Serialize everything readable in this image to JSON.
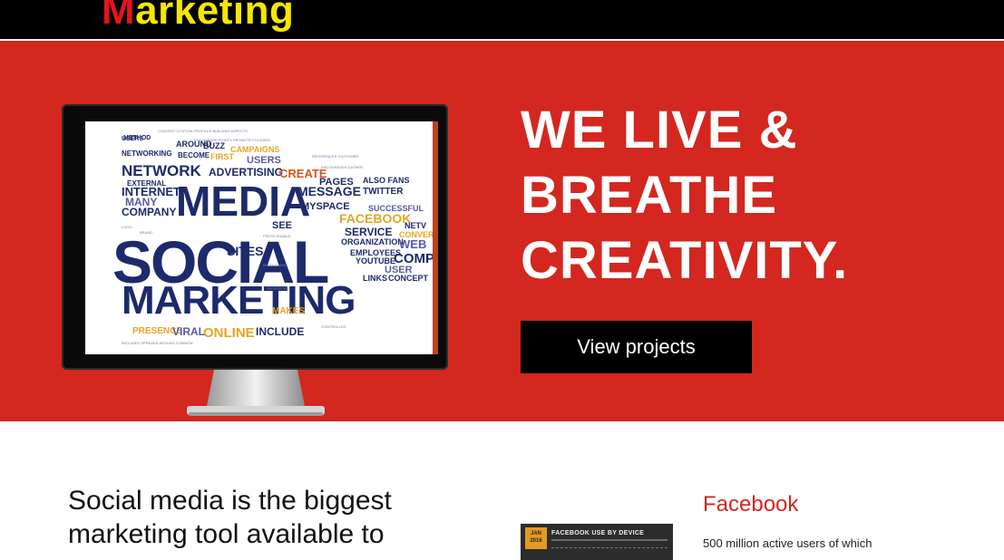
{
  "header": {
    "logo_first": "M",
    "logo_rest": "arketing",
    "background": "#000000",
    "logo_colors": {
      "first": "#e4151b",
      "rest": "#f5e700"
    }
  },
  "hero": {
    "background": "#d3271f",
    "title_lines": [
      "WE LIVE &",
      "BREATHE",
      "CREATIVITY."
    ],
    "cta_label": "View projects",
    "image": {
      "type": "monitor-wordcloud",
      "words": [
        "SOCIAL",
        "MEDIA",
        "MARKETING",
        "NETWORK",
        "ADVERTISING",
        "INTERNET",
        "COMPANY",
        "MESSAGE",
        "MYSPACE",
        "PAGES",
        "FACEBOOK",
        "SERVICE",
        "ORGANIZATION",
        "ONLINE",
        "INCLUDE",
        "VIRAL",
        "SITES",
        "PRESENCE",
        "MAKES",
        "USERS",
        "CREATE",
        "TWITTER",
        "YOUTUBE",
        "EMPLOYEES",
        "LINKS",
        "CONCEPT",
        "USER",
        "WEB",
        "COMP",
        "REFERENCES",
        "METHOD",
        "NETWORKING",
        "BECOME",
        "AROUND",
        "FIRST",
        "BUZZ",
        "CAMPAIGNS",
        "EXTERNAL",
        "MANY",
        "SUCCESSFUL",
        "ALSO",
        "FANS",
        "SEE",
        "CONVER"
      ]
    }
  },
  "content": {
    "heading": "Social media is the biggest marketing tool available to",
    "infographic": {
      "badge": "JAN 2016",
      "title": "FACEBOOK USE BY DEVICE"
    },
    "side_heading": "Facebook",
    "side_text": "500 million active users of which"
  }
}
